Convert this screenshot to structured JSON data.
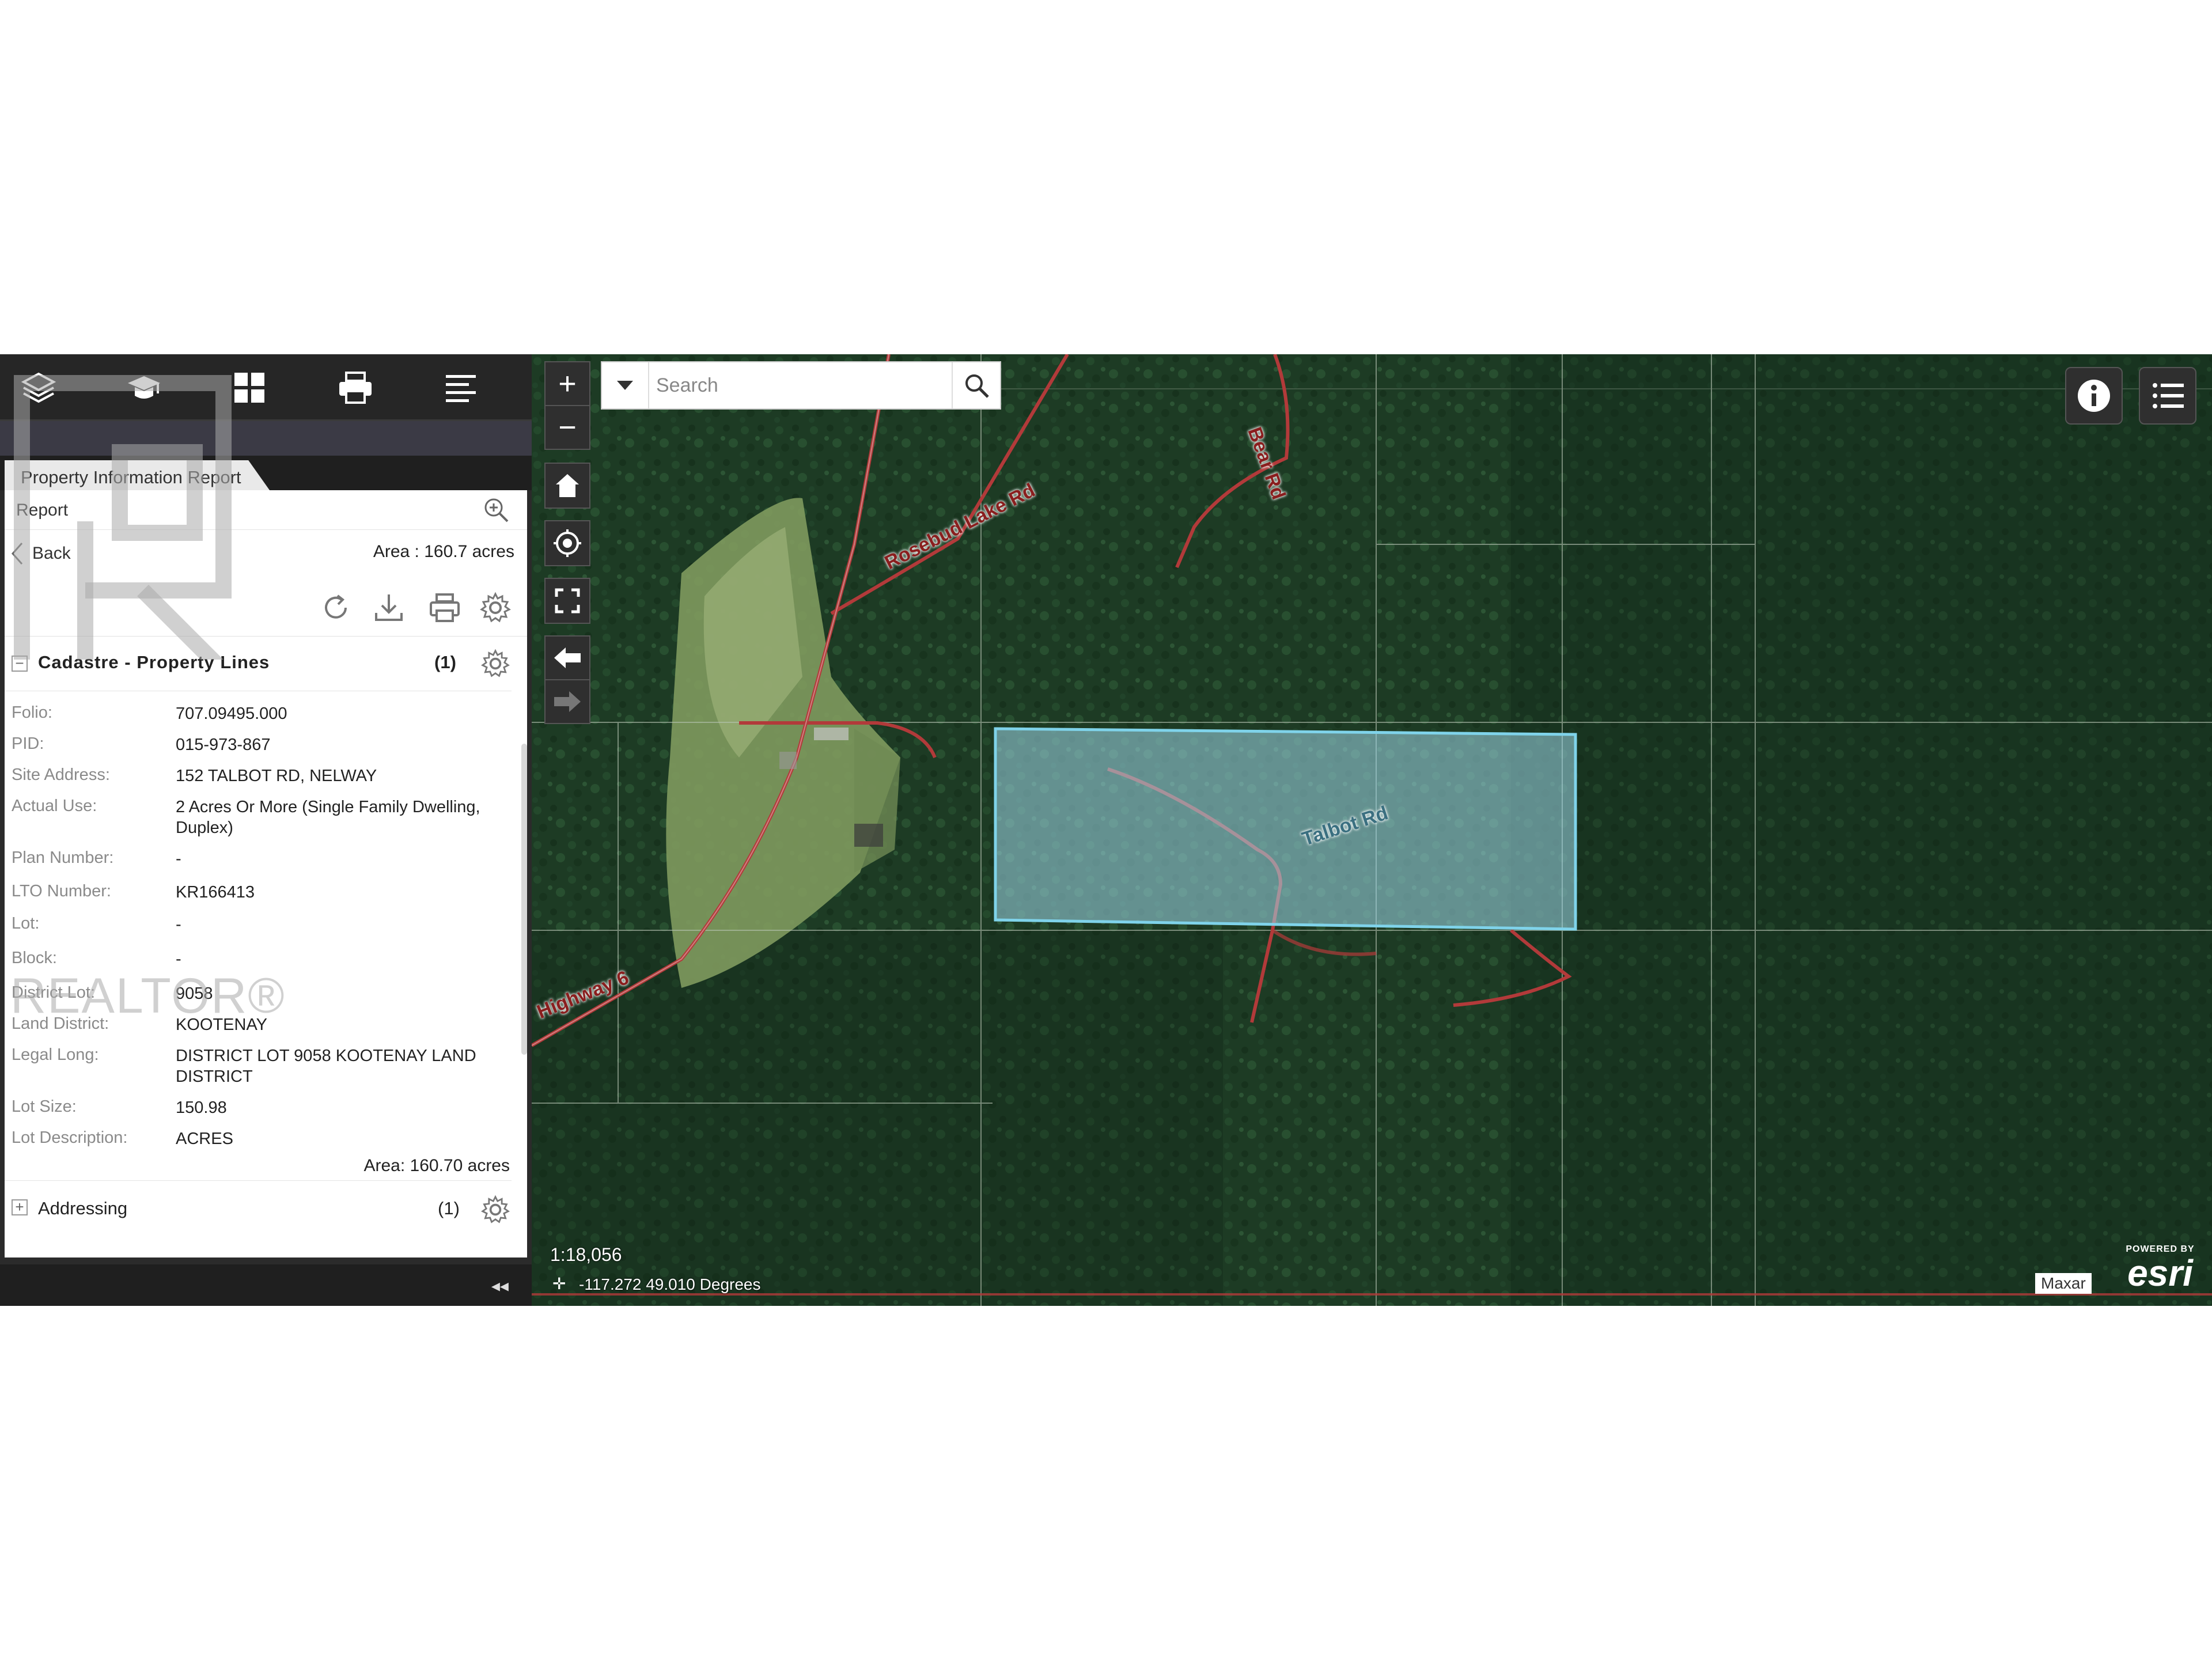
{
  "watermark": {
    "text": "REALTOR®"
  },
  "toolbar": {
    "icons": [
      "layers-icon",
      "graduation-cap-icon",
      "grid-icon",
      "printer-icon",
      "menu-icon"
    ]
  },
  "panel": {
    "tab_title": "Property Information Report",
    "report_label": "Report",
    "back_label": "Back",
    "area_summary": "Area : 160.7 acres",
    "cadastre": {
      "title": "Cadastre - Property Lines",
      "count": "(1)",
      "attributes": [
        {
          "key": "Folio:",
          "value": "707.09495.000"
        },
        {
          "key": "PID:",
          "value": "015-973-867"
        },
        {
          "key": "Site Address:",
          "value": "152 TALBOT RD, NELWAY"
        },
        {
          "key": "Actual Use:",
          "value": "2 Acres Or More (Single Family Dwelling, Duplex)"
        },
        {
          "key": "Plan Number:",
          "value": "-"
        },
        {
          "key": "LTO Number:",
          "value": "KR166413"
        },
        {
          "key": "Lot:",
          "value": "-"
        },
        {
          "key": "Block:",
          "value": "-"
        },
        {
          "key": "District Lot:",
          "value": "9058"
        },
        {
          "key": "Land District:",
          "value": "KOOTENAY"
        },
        {
          "key": "Legal Long:",
          "value": "DISTRICT LOT 9058 KOOTENAY LAND DISTRICT"
        },
        {
          "key": "Lot Size:",
          "value": "150.98"
        },
        {
          "key": "Lot Description:",
          "value": "ACRES"
        }
      ],
      "area_footer": "Area: 160.70 acres"
    },
    "addressing": {
      "title": "Addressing",
      "count": "(1)"
    },
    "collapse_label": "◂◂"
  },
  "map": {
    "search": {
      "placeholder": "Search"
    },
    "zoom_in": "+",
    "zoom_out": "−",
    "road_labels": {
      "rosebud": "Rosebud Lake Rd",
      "bear": "Bear Rd",
      "talbot": "Talbot Rd",
      "highway": "Highway 6"
    },
    "scale": "1:18,056",
    "coordinates": "-117.272 49.010 Degrees",
    "attribution": "Maxar",
    "logo": {
      "small": "POWERED BY",
      "big": "esri"
    },
    "colors": {
      "parcel_fill": "#9fd8ea",
      "parcel_stroke": "#7fd3ea",
      "road": "#b23a3a",
      "forest": "#1e3f26",
      "field": "#8aa06a"
    }
  }
}
